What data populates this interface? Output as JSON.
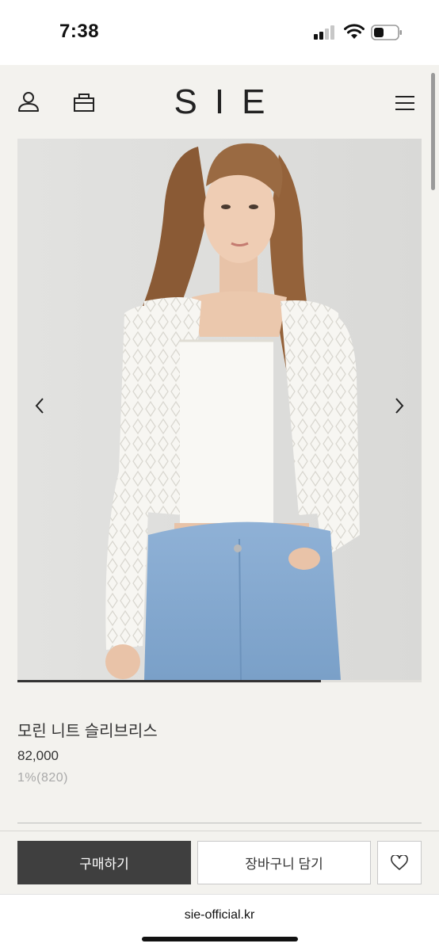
{
  "status_bar": {
    "time": "7:38"
  },
  "header": {
    "logo": "SIE"
  },
  "gallery": {
    "current_position": 0.75
  },
  "product": {
    "name": "모린 니트 슬리브리스",
    "price": "82,000",
    "points": "1%(820)"
  },
  "actions": {
    "buy_label": "구매하기",
    "cart_label": "장바구니 담기"
  },
  "browser": {
    "url": "sie-official.kr"
  },
  "colors": {
    "background": "#f3f2ee",
    "buy_button": "#3f3f3f",
    "text": "#333333",
    "muted": "#a9a9a9"
  },
  "icons": [
    "user-icon",
    "shopping-bag-icon",
    "menu-icon",
    "chevron-left-icon",
    "chevron-right-icon",
    "heart-icon"
  ]
}
